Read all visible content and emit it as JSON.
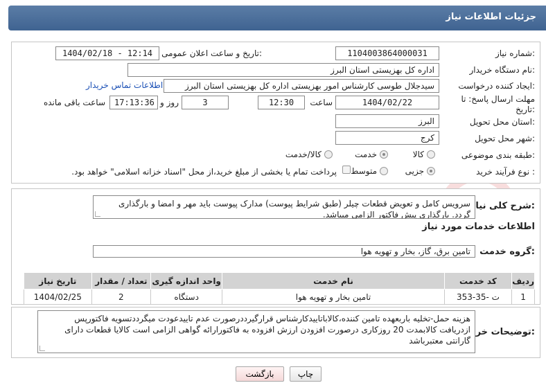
{
  "header": {
    "title": "جزئیات اطلاعات نیاز"
  },
  "form": {
    "need_number_label": "شماره نیاز:",
    "need_number": "1104003864000031",
    "announce_label": "تاریخ و ساعت اعلان عمومی:",
    "announce_value": "1404/02/18 - 12:14",
    "buyer_label": "نام دستگاه خریدار:",
    "buyer_value": "اداره کل بهزیستی استان البرز",
    "creator_label": "ایجاد کننده درخواست:",
    "creator_value": "سیدجلال طوسی کارشناس امور بهزیستی اداره کل بهزیستی استان البرز",
    "contact_link": "اطلاعات تماس خریدار",
    "deadline_label_1": "مهلت ارسال پاسخ: تا",
    "deadline_label_2": "تاریخ:",
    "deadline_date": "1404/02/22",
    "time_label": "ساعت",
    "deadline_time": "12:30",
    "days_value": "3",
    "days_label": "روز و",
    "remaining_time": "17:13:36",
    "remaining_label": "ساعت باقی مانده",
    "province_label": "استان محل تحویل:",
    "province_value": "البرز",
    "city_label": "شهر محل تحویل:",
    "city_value": "کرج",
    "category_label": "طبقه بندی موضوعی:",
    "category_options": [
      "کالا",
      "خدمت",
      "کالا/خدمت"
    ],
    "category_selected": "خدمت",
    "process_label": "نوع فرآیند خرید :",
    "process_options": [
      "جزیی",
      "متوسط"
    ],
    "process_selected": "جزیی",
    "payment_note": "پرداخت تمام یا بخشی از مبلغ خرید،از محل \"اسناد خزانه اسلامی\" خواهد بود."
  },
  "description": {
    "label": "شرح کلی نیاز:",
    "text": "سرویس کامل و تعویض قطعات چیلر (طبق شرایط پیوست) مدارک پیوست باید مهر و امضا و بارگذاری گردد. بارگذاری پیش فاکتور الزامی میباشد."
  },
  "services": {
    "section_title": "اطلاعات خدمات مورد نیاز",
    "group_label": "گروه خدمت:",
    "group_value": "تامین برق، گاز، بخار و تهویه هوا",
    "columns": [
      "ردیف",
      "کد خدمت",
      "نام خدمت",
      "واحد اندازه گیری",
      "تعداد / مقدار",
      "تاریخ نیاز"
    ],
    "rows": [
      [
        "1",
        "ت -35-353",
        "تامین بخار و تهویه هوا",
        "دستگاه",
        "2",
        "1404/02/25"
      ]
    ]
  },
  "buyer_notes": {
    "label": "توضیحات خریدار:",
    "text": "هزینه حمل-تخلیه باربعهده تامین کننده،کالاباتاییدکارشناس قرارگیرددرصورت عدم تاییدعودت میگرددتسویه فاکتورپس ازدریافت کالابمدت 20 روزکاری درصورت افزودن ارزش افزوده به فاکتورارائه گواهی الزامی است کالایا قطعات دارای گارانتی معتبرباشد"
  },
  "buttons": {
    "print": "چاپ",
    "back": "بازگشت"
  },
  "watermark": {
    "text": "AriaTender.neT"
  },
  "colors": {
    "header": "#4a6e9c",
    "link": "#1a4fb5",
    "table_header": "#d3d3d3"
  }
}
